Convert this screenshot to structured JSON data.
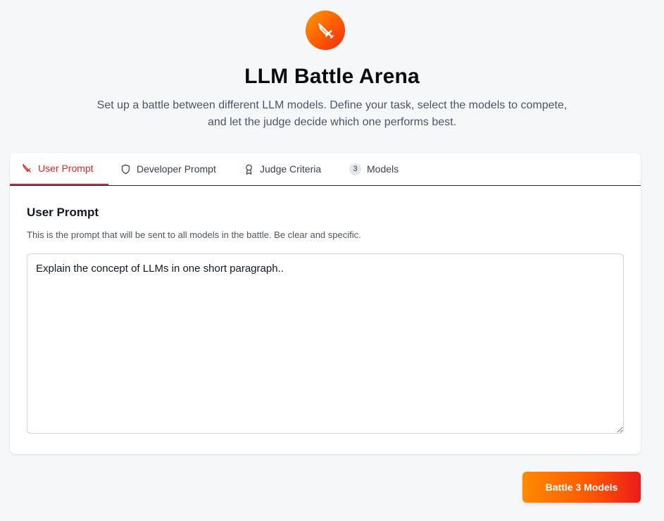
{
  "header": {
    "logo_icon": "sword-icon",
    "title": "LLM Battle Arena",
    "subtitle": "Set up a battle between different LLM models. Define your task, select the models to compete, and let the judge decide which one performs best."
  },
  "tabs": [
    {
      "label": "User Prompt",
      "icon": "sword-icon",
      "active": true
    },
    {
      "label": "Developer Prompt",
      "icon": "shield-icon",
      "active": false
    },
    {
      "label": "Judge Criteria",
      "icon": "award-icon",
      "active": false
    },
    {
      "label": "Models",
      "badge": "3",
      "active": false
    }
  ],
  "panel": {
    "title": "User Prompt",
    "description": "This is the prompt that will be sent to all models in the battle. Be clear and specific.",
    "prompt_value": "Explain the concept of LLMs in one short paragraph.."
  },
  "actions": {
    "battle_label": "Battle 3 Models"
  },
  "colors": {
    "accent": "#dc2626",
    "gradient_start": "#ff8a00",
    "gradient_end": "#ec1c1c",
    "background": "#f6f7f9"
  }
}
